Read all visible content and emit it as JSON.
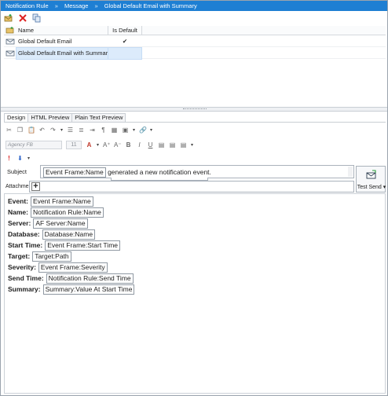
{
  "breadcrumb": [
    "Notification Rule",
    "Message",
    "Global Default Email with Summary"
  ],
  "breadcrumb_sep": "»",
  "toolbar1": {
    "icons": [
      "new-email-icon",
      "delete-icon",
      "copy-icon"
    ]
  },
  "grid": {
    "headers": {
      "name": "Name",
      "is_default": "Is Default"
    },
    "rows": [
      {
        "name": "Global Default Email",
        "is_default": "✔"
      },
      {
        "name": "Global Default Email with Summary",
        "is_default": ""
      }
    ]
  },
  "tabs": [
    "Design",
    "HTML Preview",
    "Plain Text Preview"
  ],
  "formatting": {
    "font_value": "Agency FB",
    "size_value": "11"
  },
  "subject": {
    "label": "Subject",
    "token": "Event Frame:Name",
    "text": " generated a new notification event."
  },
  "attachments": {
    "label": "Attachments",
    "add": "+"
  },
  "test_send": {
    "label": "Test Send",
    "caret": "▾"
  },
  "body": [
    {
      "label": "Event:",
      "token": "Event Frame:Name"
    },
    {
      "label": "Name:",
      "token": "Notification Rule:Name"
    },
    {
      "label": "Server:",
      "token": "AF Server:Name"
    },
    {
      "label": "Database:",
      "token": "Database:Name"
    },
    {
      "label": "Start Time:",
      "token": "Event Frame:Start Time"
    },
    {
      "label": "Target:",
      "token": "Target:Path"
    },
    {
      "label": "Severity:",
      "token": "Event Frame:Severity"
    },
    {
      "label": "Send Time:",
      "token": "Notification Rule:Send Time"
    },
    {
      "label": "Summary:",
      "token": "Summary:Value At Start Time"
    }
  ],
  "colors": {
    "titlebar": "#1e7fd3",
    "selection": "#dcebfb"
  }
}
